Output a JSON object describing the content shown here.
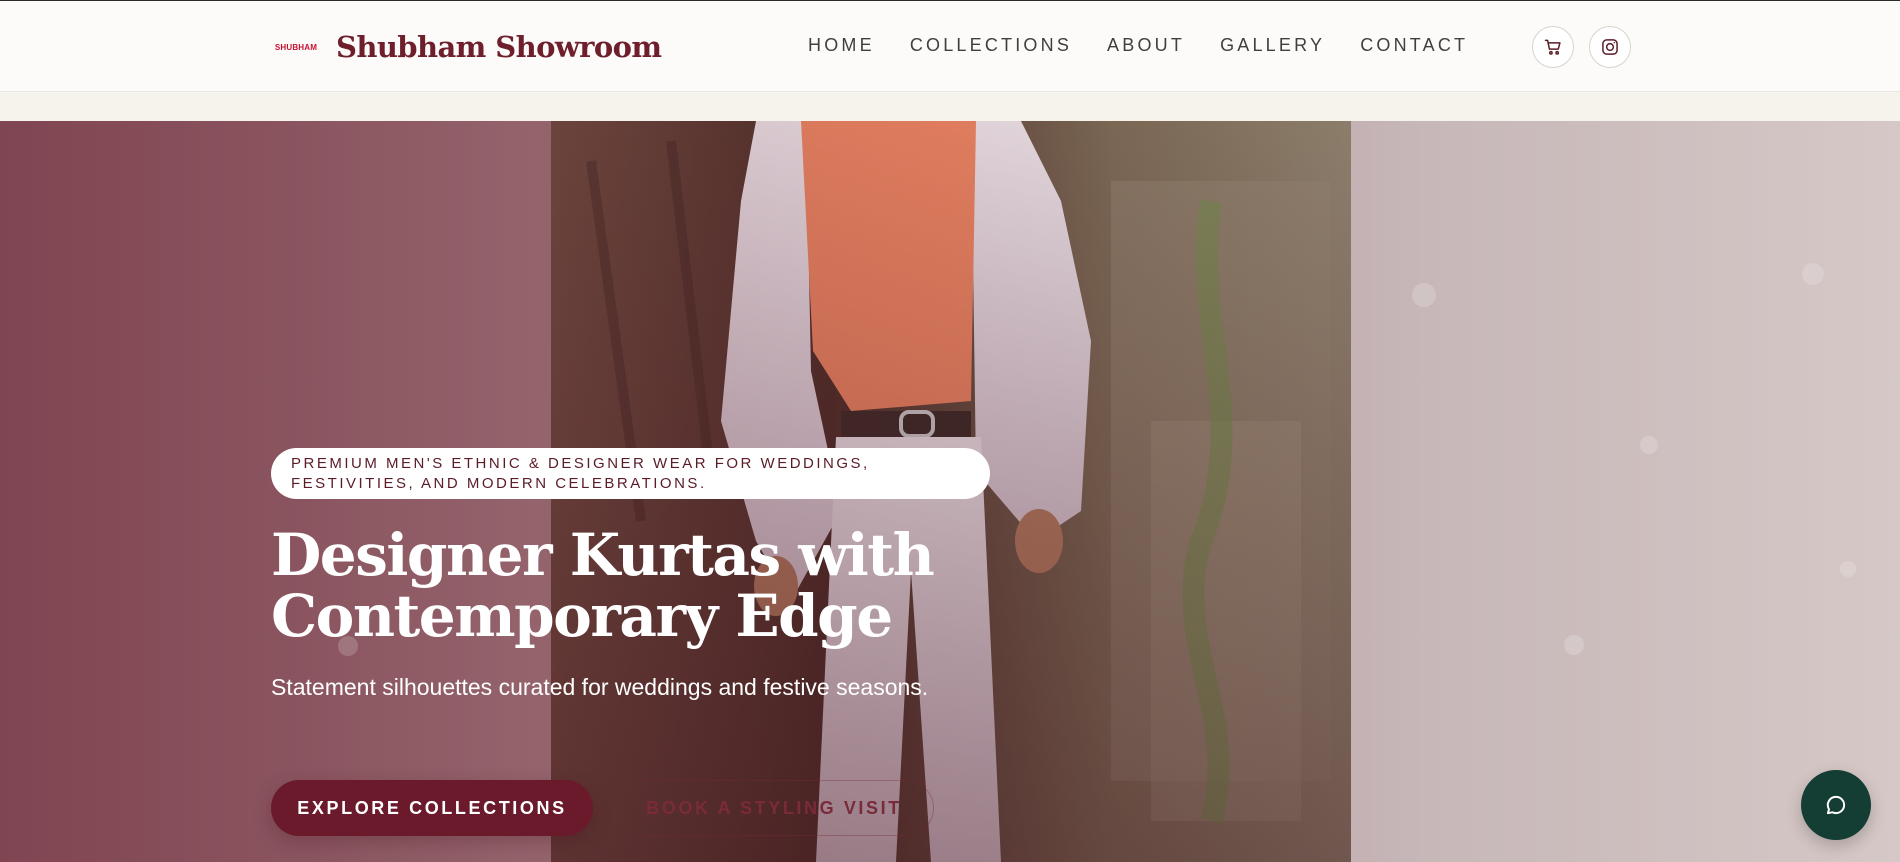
{
  "header": {
    "logo_text": "SHUBHAM",
    "brand_name": "Shubham Showroom",
    "nav": [
      {
        "label": "HOME"
      },
      {
        "label": "COLLECTIONS"
      },
      {
        "label": "ABOUT"
      },
      {
        "label": "GALLERY"
      },
      {
        "label": "CONTACT"
      }
    ],
    "icons": {
      "cart": "cart-icon",
      "instagram": "instagram-icon"
    }
  },
  "hero": {
    "tagline": "PREMIUM MEN'S ETHNIC & DESIGNER WEAR FOR WEDDINGS, FESTIVITIES, AND MODERN CELEBRATIONS.",
    "title": "Designer Kurtas with Contemporary Edge",
    "subtitle": "Statement silhouettes curated for weddings and festive seasons.",
    "primary_cta": "EXPLORE COLLECTIONS",
    "secondary_cta": "BOOK A STYLING VISIT"
  },
  "chat": {
    "icon": "chat-bubble-icon"
  },
  "colors": {
    "brand": "#6e1f2b",
    "primary_button": "#6a1a2a",
    "logo_red": "#c8102e",
    "chat_button": "#143d33"
  }
}
